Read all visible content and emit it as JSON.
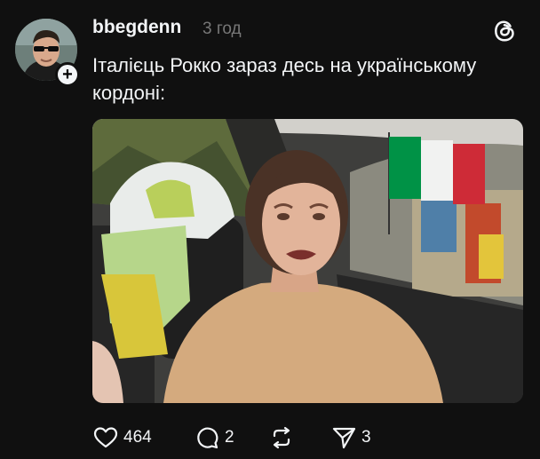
{
  "post": {
    "username": "bbegdenn",
    "time": "3 год",
    "text": "Італієць Рокко зараз десь на українському кордоні:"
  },
  "avatar": {
    "icon": "user-avatar",
    "follow_label": "+"
  },
  "header": {
    "logo": "threads-logo-icon"
  },
  "actions": {
    "like_count": "464",
    "reply_count": "2",
    "repost_count": "",
    "share_count": "3"
  },
  "colors": {
    "background": "#101010",
    "text": "#f3f5f7",
    "muted": "#777777",
    "flag_green": "#009246",
    "flag_white": "#f1f2f1",
    "flag_red": "#ce2b37"
  }
}
